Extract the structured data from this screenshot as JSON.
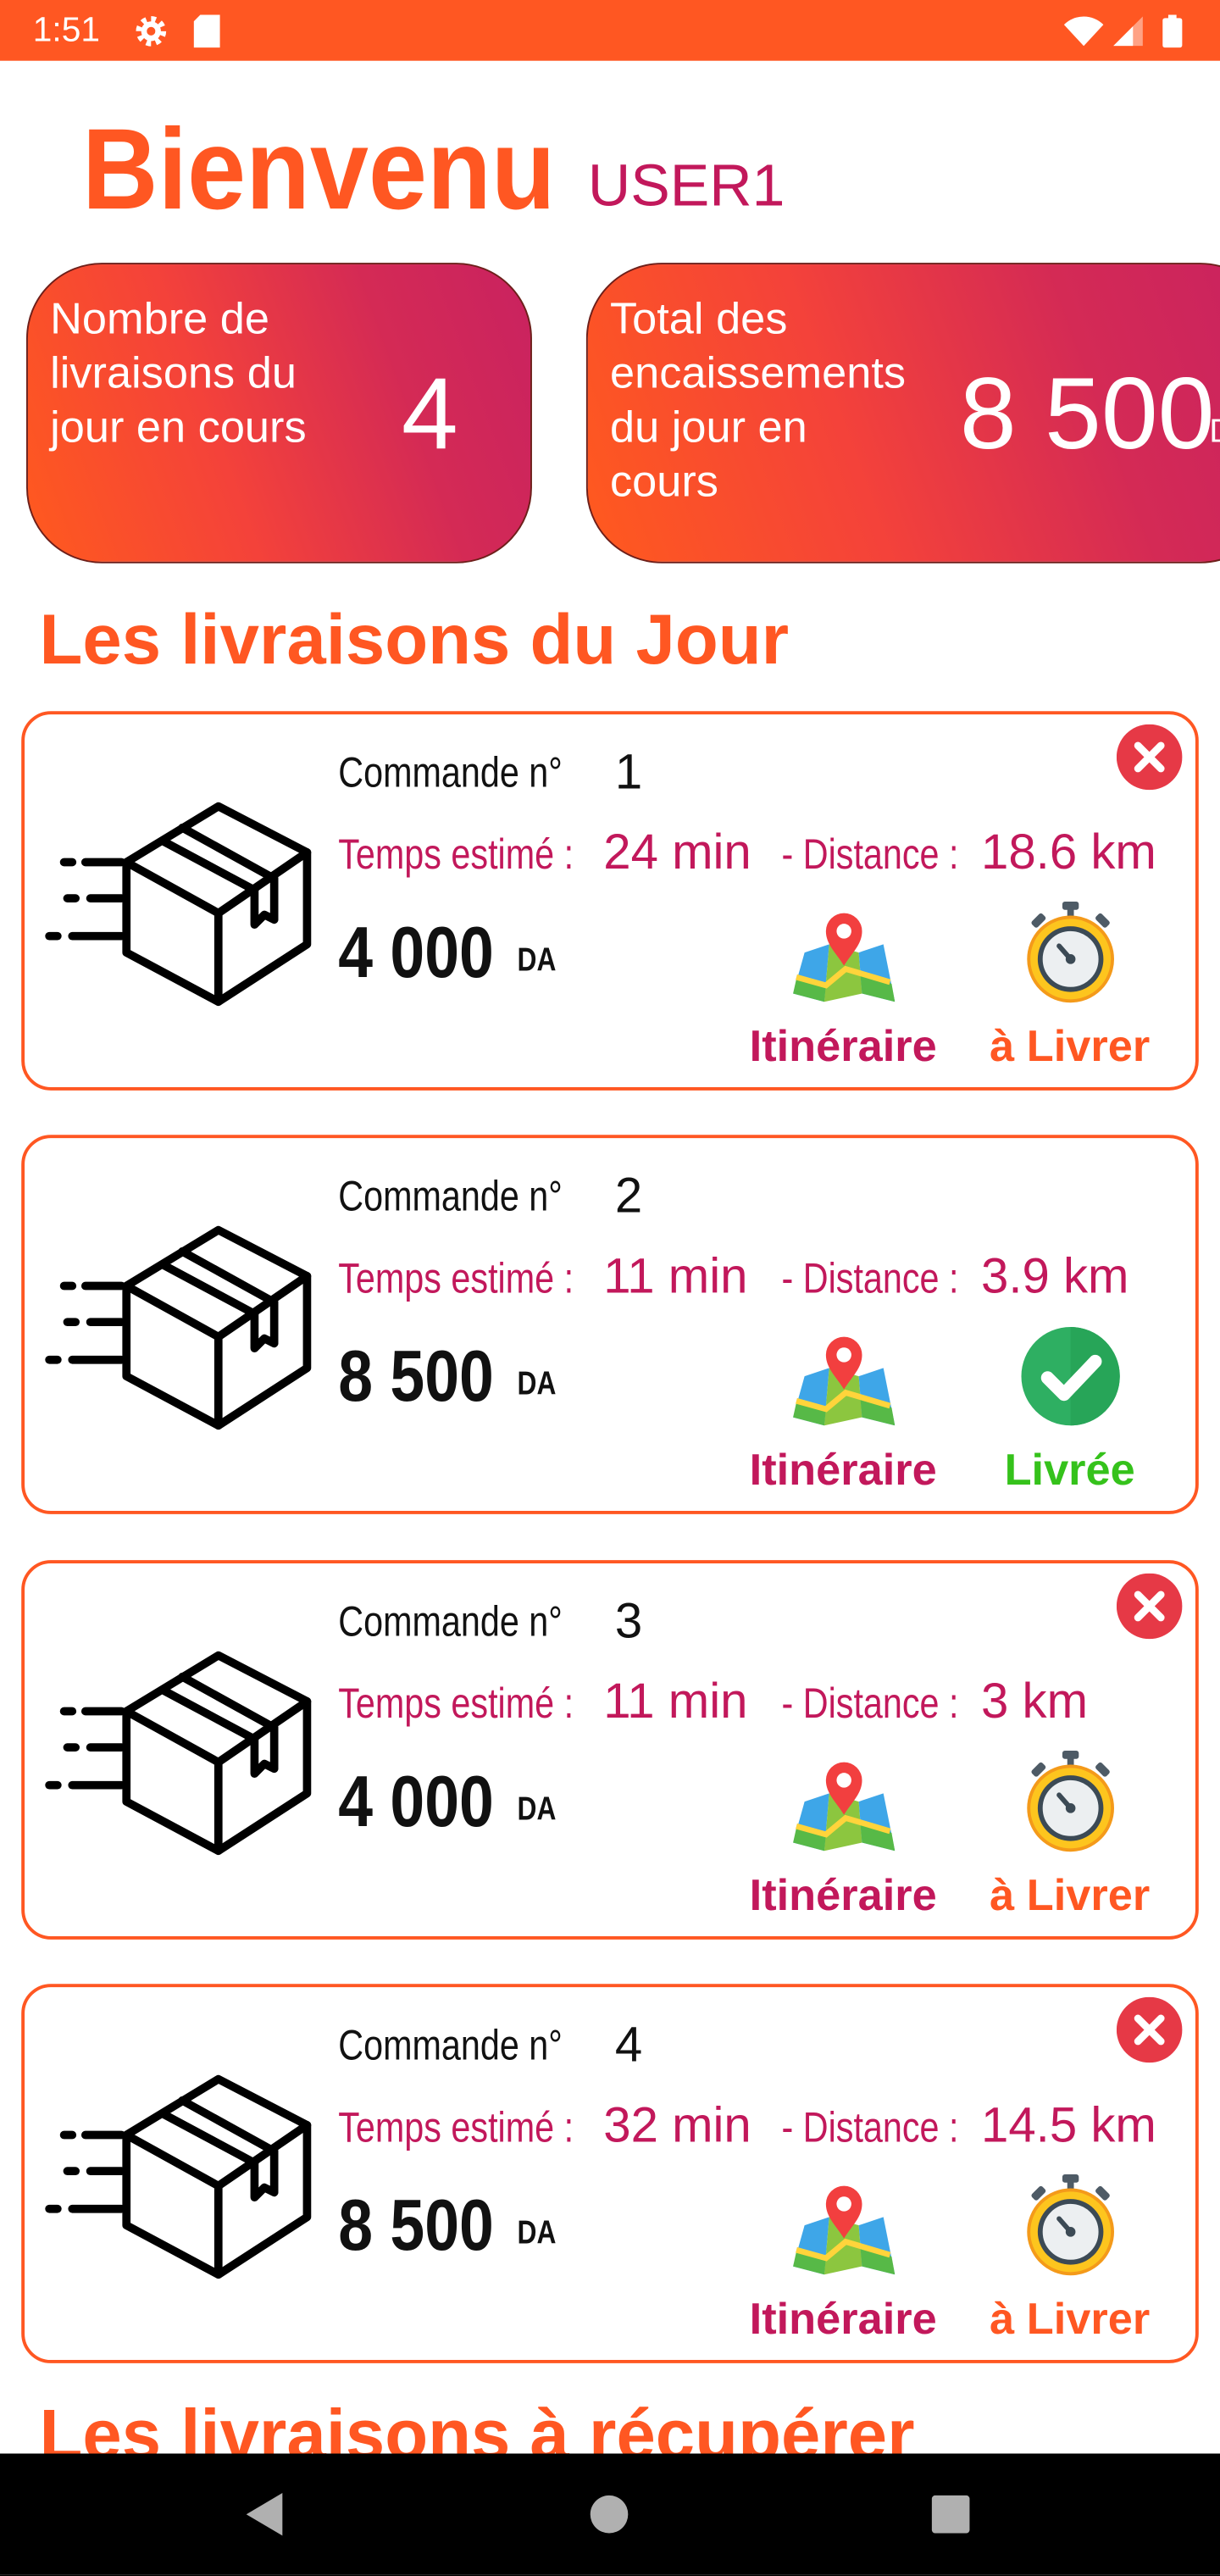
{
  "status_bar": {
    "time": "1:51",
    "left_icons": [
      "gear-icon",
      "sd-card-icon"
    ],
    "right_icons": [
      "wifi-icon",
      "signal-icon",
      "battery-icon"
    ]
  },
  "header": {
    "greeting": "Bienvenu",
    "username": "USER1"
  },
  "summary": {
    "deliveries_in_progress": {
      "label_lines": [
        "Nombre de",
        "livraisons du",
        "jour en cours"
      ],
      "value": "4"
    },
    "collections_total": {
      "label_lines": [
        "Total des",
        "encaissements",
        "du jour en",
        "cours"
      ],
      "value": "8 500",
      "unit": "DA"
    }
  },
  "today_section": {
    "title": "Les livraisons du Jour",
    "labels": {
      "order": "Commande n°",
      "time": "Temps estimé :",
      "distance": "- Distance :",
      "route": "Itinéraire"
    },
    "route_icon": "map-icon",
    "deliveries": [
      {
        "order_number": "1",
        "estimated_time": "24 min",
        "distance": "18.6 km",
        "amount": "4 000",
        "currency": "DA",
        "status": "à Livrer",
        "status_icon": "stopwatch-icon",
        "cancel_icon": "close-icon"
      },
      {
        "order_number": "2",
        "estimated_time": "11 min",
        "distance": "3.9 km",
        "amount": "8 500",
        "currency": "DA",
        "status": "Livrée",
        "status_icon": "check-icon"
      },
      {
        "order_number": "3",
        "estimated_time": "11 min",
        "distance": "3 km",
        "amount": "4 000",
        "currency": "DA",
        "status": "à Livrer",
        "status_icon": "stopwatch-icon",
        "cancel_icon": "close-icon"
      },
      {
        "order_number": "4",
        "estimated_time": "32 min",
        "distance": "14.5 km",
        "amount": "8 500",
        "currency": "DA",
        "status": "à Livrer",
        "status_icon": "stopwatch-icon",
        "cancel_icon": "close-icon"
      }
    ]
  },
  "pickup_section": {
    "title": "Les livraisons à récupérer"
  },
  "nav_bar": {
    "icons": [
      "back-icon",
      "home-icon",
      "recents-icon"
    ]
  },
  "colors": {
    "primary": "#FF5722",
    "accent": "#C2185B",
    "success": "#35C21B",
    "danger": "#E63946"
  }
}
